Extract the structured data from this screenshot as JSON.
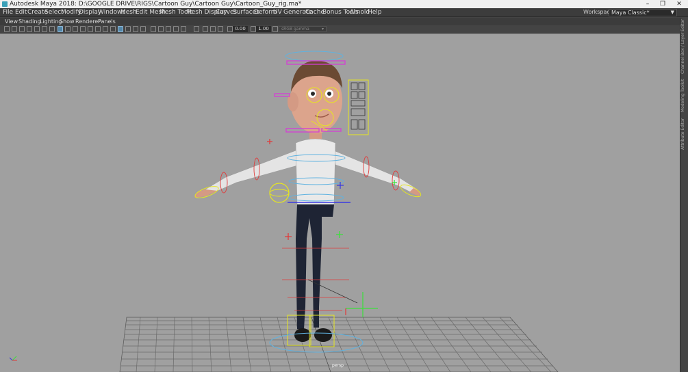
{
  "window": {
    "title": "Autodesk Maya 2018: D:\\GOOGLE DRIVE\\RIGS\\Cartoon Guy\\Cartoon Guy\\Cartoon_Guy_rig.ma*",
    "minimize": "–",
    "maximize": "❐",
    "close": "✕"
  },
  "menubar": {
    "items": [
      "File",
      "Edit",
      "Create",
      "Select",
      "Modify",
      "Display",
      "Windows",
      "Mesh",
      "Edit Mesh",
      "Mesh Tools",
      "Mesh Display",
      "Curves",
      "Surfaces",
      "Deform",
      "UV",
      "Generate",
      "Cache",
      "Bonus Tools",
      "Arnold",
      "Help"
    ],
    "workspace_label": "Workspace :",
    "workspace_value": "Maya Classic*"
  },
  "panel_menu": {
    "items": [
      "View",
      "Shading",
      "Lighting",
      "Show",
      "Renderer",
      "Panels"
    ]
  },
  "toolbar": {
    "exposure_value": "0.00",
    "gamma_value": "1.00",
    "color_space": "sRGB gamma"
  },
  "side_tabs": {
    "channel_box": "Channel Box / Layer Editor",
    "modeling_toolkit": "Modeling Toolkit",
    "attribute_editor": "Attribute Editor"
  },
  "viewport": {
    "camera": "persp",
    "background": "#a0a0a0"
  }
}
